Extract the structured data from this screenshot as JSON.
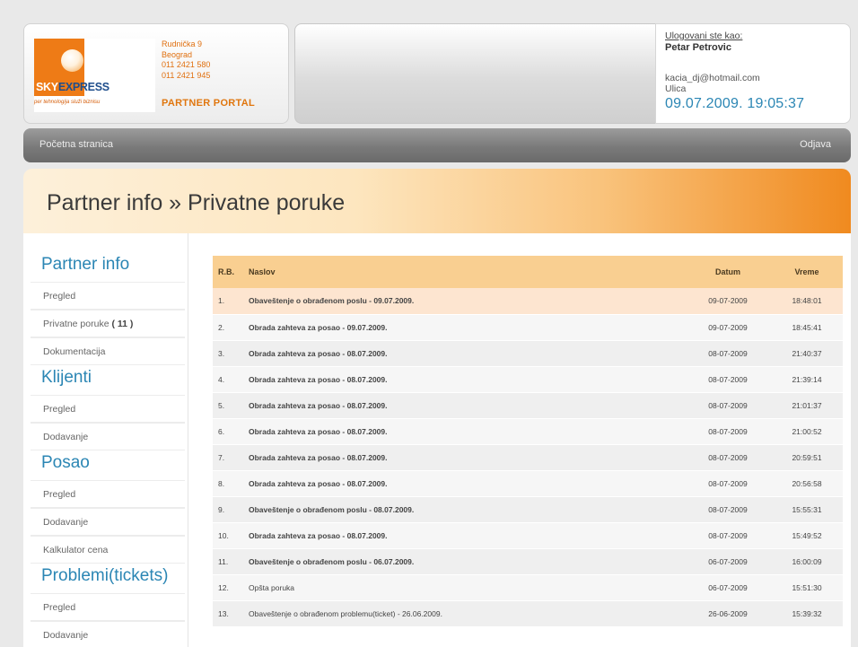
{
  "header": {
    "logo": {
      "sky": "SKY",
      "express": "EXPRESS",
      "slogan": "per tehnologija služi biznisu"
    },
    "address": [
      "Rudnička 9",
      "Beograd",
      "011 2421 580",
      "011 2421 945"
    ],
    "portal_label": "PARTNER PORTAL",
    "user": {
      "caption": "Ulogovani ste kao:",
      "name": "Petar Petrovic",
      "email": "kacia_dj@hotmail.com",
      "street": "Ulica",
      "datetime": "09.07.2009. 19:05:37"
    }
  },
  "nav": {
    "home": "Početna stranica",
    "logout": "Odjava"
  },
  "page_title": "Partner info » Privatne poruke",
  "sidebar": {
    "partner": {
      "title": "Partner info",
      "items": [
        "Pregled",
        "Privatne poruke",
        "Dokumentacija"
      ],
      "unread_count": "( 11 )"
    },
    "clients": {
      "title": "Klijenti",
      "items": [
        "Pregled",
        "Dodavanje"
      ]
    },
    "jobs": {
      "title": "Posao",
      "items": [
        "Pregled",
        "Dodavanje",
        "Kalkulator cena"
      ]
    },
    "problems": {
      "title": "Problemi(tickets)",
      "items": [
        "Pregled",
        "Dodavanje"
      ]
    }
  },
  "table": {
    "headers": {
      "num": "R.B.",
      "title": "Naslov",
      "date": "Datum",
      "time": "Vreme"
    },
    "rows": [
      {
        "num": "1.",
        "title": "Obaveštenje o obrađenom poslu - 09.07.2009.",
        "date": "09-07-2009",
        "time": "18:48:01"
      },
      {
        "num": "2.",
        "title": "Obrada zahteva za posao - 09.07.2009.",
        "date": "09-07-2009",
        "time": "18:45:41"
      },
      {
        "num": "3.",
        "title": "Obrada zahteva za posao - 08.07.2009.",
        "date": "08-07-2009",
        "time": "21:40:37"
      },
      {
        "num": "4.",
        "title": "Obrada zahteva za posao - 08.07.2009.",
        "date": "08-07-2009",
        "time": "21:39:14"
      },
      {
        "num": "5.",
        "title": "Obrada zahteva za posao - 08.07.2009.",
        "date": "08-07-2009",
        "time": "21:01:37"
      },
      {
        "num": "6.",
        "title": "Obrada zahteva za posao - 08.07.2009.",
        "date": "08-07-2009",
        "time": "21:00:52"
      },
      {
        "num": "7.",
        "title": "Obrada zahteva za posao - 08.07.2009.",
        "date": "08-07-2009",
        "time": "20:59:51"
      },
      {
        "num": "8.",
        "title": "Obrada zahteva za posao - 08.07.2009.",
        "date": "08-07-2009",
        "time": "20:56:58"
      },
      {
        "num": "9.",
        "title": "Obaveštenje o obrađenom poslu - 08.07.2009.",
        "date": "08-07-2009",
        "time": "15:55:31"
      },
      {
        "num": "10.",
        "title": "Obrada zahteva za posao - 08.07.2009.",
        "date": "08-07-2009",
        "time": "15:49:52"
      },
      {
        "num": "11.",
        "title": "Obaveštenje o obrađenom poslu - 06.07.2009.",
        "date": "06-07-2009",
        "time": "16:00:09"
      },
      {
        "num": "12.",
        "title": "Opšta poruka",
        "date": "06-07-2009",
        "time": "15:51:30"
      },
      {
        "num": "13.",
        "title": "Obaveštenje o obrađenom problemu(ticket) - 26.06.2009.",
        "date": "26-06-2009",
        "time": "15:39:32"
      }
    ]
  },
  "colors": {
    "accent_blue": "#2b86b4",
    "accent_orange": "#ee7b16",
    "header_row": "#f9cf91",
    "highlight_row": "#fde5d0"
  }
}
